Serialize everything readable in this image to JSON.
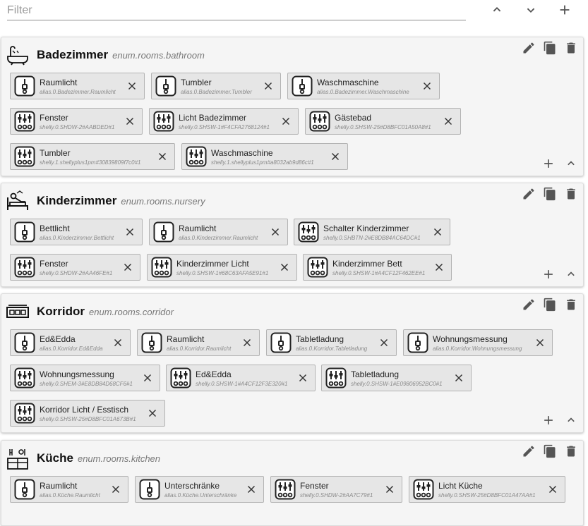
{
  "toolbar": {
    "filter_placeholder": "Filter",
    "up_icon": "chevron-up-icon",
    "down_icon": "chevron-down-icon",
    "add_icon": "plus-icon"
  },
  "rooms": [
    {
      "name": "Badezimmer",
      "enum": "enum.rooms.bathroom",
      "icon": "bathtub-icon",
      "devices": [
        {
          "name": "Raumlicht",
          "id": "alias.0.Badezimmer.Raumlicht",
          "type": "alias"
        },
        {
          "name": "Tumbler",
          "id": "alias.0.Badezimmer.Tumbler",
          "type": "alias"
        },
        {
          "name": "Waschmaschine",
          "id": "alias.0.Badezimmer.Waschmaschine",
          "type": "alias"
        },
        {
          "name": "Fenster",
          "id": "shelly.0.SHDW-2#AABDED#1",
          "type": "device"
        },
        {
          "name": "Licht Badezimmer",
          "id": "shelly.0.SHSW-1#F4CFA2768124#1",
          "type": "device"
        },
        {
          "name": "Gästebad",
          "id": "shelly.0.SHSW-25#D8BFC01A50A8#1",
          "type": "device"
        },
        {
          "name": "Tumbler",
          "id": "shelly.1.shellyplus1pm#30839809f7c0#1",
          "type": "device"
        },
        {
          "name": "Waschmaschine",
          "id": "shelly.1.shellyplus1pm#a8032ab9d86c#1",
          "type": "device"
        }
      ]
    },
    {
      "name": "Kinderzimmer",
      "enum": "enum.rooms.nursery",
      "icon": "crib-icon",
      "devices": [
        {
          "name": "Bettlicht",
          "id": "alias.0.Kinderzimmer.Bettlicht",
          "type": "alias"
        },
        {
          "name": "Raumlicht",
          "id": "alias.0.Kinderzimmer.Raumlicht",
          "type": "alias"
        },
        {
          "name": "Schalter Kinderzimmer",
          "id": "shelly.0.SHBTN-2#E8DB84AC64DC#1",
          "type": "device"
        },
        {
          "name": "Fenster",
          "id": "shelly.0.SHDW-2#AA46FE#1",
          "type": "device"
        },
        {
          "name": "Kinderzimmer Licht",
          "id": "shelly.0.SHSW-1#68C63AFA5E91#1",
          "type": "device"
        },
        {
          "name": "Kinderzimmer Bett",
          "id": "shelly.0.SHSW-1#A4CF12F462EE#1",
          "type": "device"
        }
      ]
    },
    {
      "name": "Korridor",
      "enum": "enum.rooms.corridor",
      "icon": "corridor-icon",
      "devices": [
        {
          "name": "Ed&Edda",
          "id": "alias.0.Korridor.Ed&Edda",
          "type": "alias"
        },
        {
          "name": "Raumlicht",
          "id": "alias.0.Korridor.Raumlicht",
          "type": "alias"
        },
        {
          "name": "Tabletladung",
          "id": "alias.0.Korridor.Tabletladung",
          "type": "alias"
        },
        {
          "name": "Wohnungsmessung",
          "id": "alias.0.Korridor.Wohnungsmessung",
          "type": "alias"
        },
        {
          "name": "Wohnungsmessung",
          "id": "shelly.0.SHEM-3#E8DB84D68CF6#1",
          "type": "device"
        },
        {
          "name": "Ed&Edda",
          "id": "shelly.0.SHSW-1#A4CF12F3E320#1",
          "type": "device"
        },
        {
          "name": "Tabletladung",
          "id": "shelly.0.SHSW-1#E09806952BC0#1",
          "type": "device"
        },
        {
          "name": "Korridor Licht / Esstisch",
          "id": "shelly.0.SHSW-25#D8BFC01A673B#1",
          "type": "device"
        }
      ]
    },
    {
      "name": "Küche",
      "enum": "enum.rooms.kitchen",
      "icon": "kitchen-icon",
      "devices": [
        {
          "name": "Raumlicht",
          "id": "alias.0.Küche.Raumlicht",
          "type": "alias"
        },
        {
          "name": "Unterschränke",
          "id": "alias.0.Küche.Unterschränke",
          "type": "alias"
        },
        {
          "name": "Fenster",
          "id": "shelly.0.SHDW-2#AA7C79#1",
          "type": "device"
        },
        {
          "name": "Licht Küche",
          "id": "shelly.0.SHSW-25#D8BFC01A47AA#1",
          "type": "device"
        }
      ]
    }
  ]
}
